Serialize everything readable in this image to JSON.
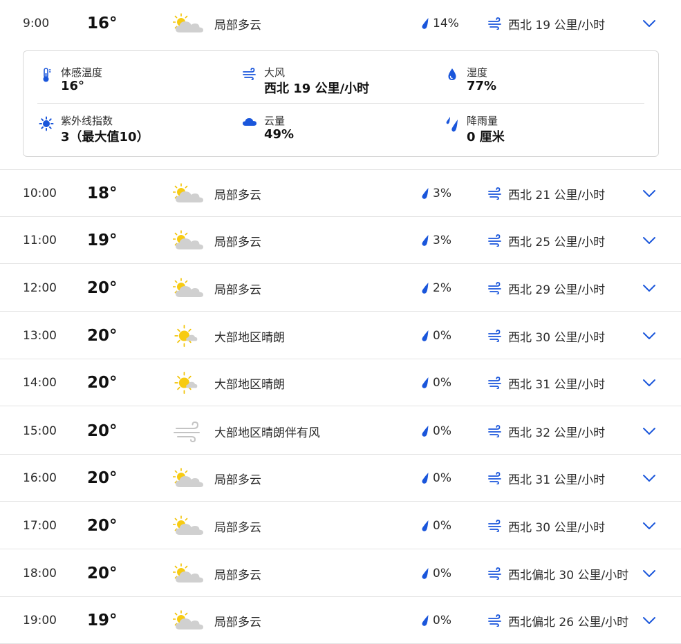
{
  "hours": [
    {
      "time": "9:00",
      "temp": "16°",
      "icon": "partly-cloudy-icon",
      "condition": "局部多云",
      "precip": "14%",
      "wind": "西北 19 公里/小时",
      "expanded": true
    },
    {
      "time": "10:00",
      "temp": "18°",
      "icon": "partly-cloudy-icon",
      "condition": "局部多云",
      "precip": "3%",
      "wind": "西北 21 公里/小时"
    },
    {
      "time": "11:00",
      "temp": "19°",
      "icon": "partly-cloudy-icon",
      "condition": "局部多云",
      "precip": "3%",
      "wind": "西北 25 公里/小时"
    },
    {
      "time": "12:00",
      "temp": "20°",
      "icon": "partly-cloudy-icon",
      "condition": "局部多云",
      "precip": "2%",
      "wind": "西北 29 公里/小时"
    },
    {
      "time": "13:00",
      "temp": "20°",
      "icon": "mostly-sunny-icon",
      "condition": "大部地区晴朗",
      "precip": "0%",
      "wind": "西北 30 公里/小时"
    },
    {
      "time": "14:00",
      "temp": "20°",
      "icon": "mostly-sunny-icon",
      "condition": "大部地区晴朗",
      "precip": "0%",
      "wind": "西北 31 公里/小时"
    },
    {
      "time": "15:00",
      "temp": "20°",
      "icon": "windy-icon",
      "condition": "大部地区晴朗伴有风",
      "precip": "0%",
      "wind": "西北 32 公里/小时"
    },
    {
      "time": "16:00",
      "temp": "20°",
      "icon": "partly-cloudy-icon",
      "condition": "局部多云",
      "precip": "0%",
      "wind": "西北 31 公里/小时"
    },
    {
      "time": "17:00",
      "temp": "20°",
      "icon": "partly-cloudy-icon",
      "condition": "局部多云",
      "precip": "0%",
      "wind": "西北 30 公里/小时"
    },
    {
      "time": "18:00",
      "temp": "20°",
      "icon": "partly-cloudy-icon",
      "condition": "局部多云",
      "precip": "0%",
      "wind": "西北偏北 30 公里/小时"
    },
    {
      "time": "19:00",
      "temp": "19°",
      "icon": "partly-cloudy-icon",
      "condition": "局部多云",
      "precip": "0%",
      "wind": "西北偏北 26 公里/小时"
    }
  ],
  "details": {
    "feels_like": {
      "label": "体感温度",
      "value": "16°",
      "icon": "thermometer-icon"
    },
    "gust": {
      "label": "大风",
      "value": "西北 19 公里/小时",
      "icon": "wind-icon"
    },
    "humidity": {
      "label": "湿度",
      "value": "77%",
      "icon": "humidity-drop-icon"
    },
    "uv": {
      "label": "紫外线指数",
      "value": "3（最大值10）",
      "icon": "uv-sun-icon"
    },
    "cloud": {
      "label": "云量",
      "value": "49%",
      "icon": "cloud-icon"
    },
    "rain": {
      "label": "降雨量",
      "value": "0 厘米",
      "icon": "rain-icon"
    }
  },
  "colors": {
    "accent": "#1a56db",
    "sun": "#f5c518",
    "cloud": "#d4d4d4"
  }
}
